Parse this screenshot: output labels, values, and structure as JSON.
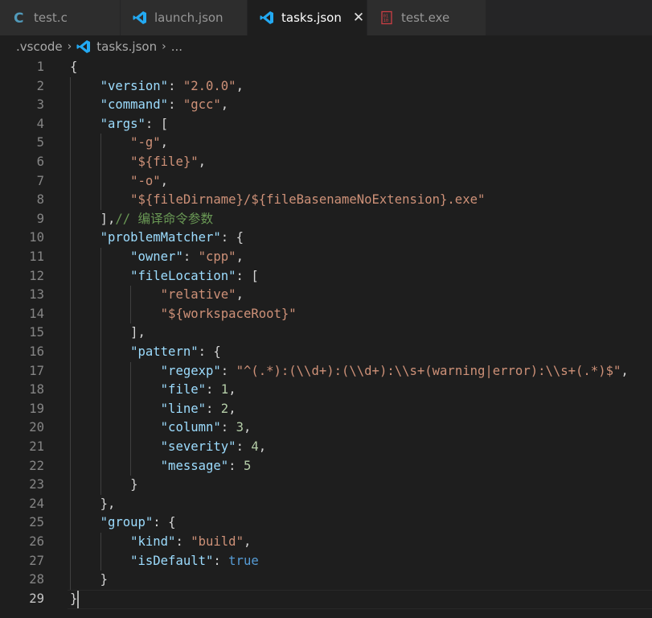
{
  "tabs": [
    {
      "label": "test.c",
      "icon": "c-file-icon",
      "icon_color": "#519aba",
      "active": false
    },
    {
      "label": "launch.json",
      "icon": "vscode-icon",
      "icon_color": "#23a9f2",
      "active": false
    },
    {
      "label": "tasks.json",
      "icon": "vscode-icon",
      "icon_color": "#23a9f2",
      "active": true,
      "close_glyph": "✕"
    },
    {
      "label": "test.exe",
      "icon": "binary-file-icon",
      "icon_color": "#cc3e44",
      "active": false
    }
  ],
  "breadcrumb": {
    "folder": ".vscode",
    "separator": "›",
    "file": "tasks.json",
    "more": "..."
  },
  "editor": {
    "current_line": 29,
    "lines": [
      {
        "num": "1",
        "code": "{"
      },
      {
        "num": "2",
        "code": "    \"version\": \"2.0.0\","
      },
      {
        "num": "3",
        "code": "    \"command\": \"gcc\","
      },
      {
        "num": "4",
        "code": "    \"args\": ["
      },
      {
        "num": "5",
        "code": "        \"-g\","
      },
      {
        "num": "6",
        "code": "        \"${file}\","
      },
      {
        "num": "7",
        "code": "        \"-o\","
      },
      {
        "num": "8",
        "code": "        \"${fileDirname}/${fileBasenameNoExtension}.exe\""
      },
      {
        "num": "9",
        "code": "    ],// 编译命令参数"
      },
      {
        "num": "10",
        "code": "    \"problemMatcher\": {"
      },
      {
        "num": "11",
        "code": "        \"owner\": \"cpp\","
      },
      {
        "num": "12",
        "code": "        \"fileLocation\": ["
      },
      {
        "num": "13",
        "code": "            \"relative\","
      },
      {
        "num": "14",
        "code": "            \"${workspaceRoot}\""
      },
      {
        "num": "15",
        "code": "        ],"
      },
      {
        "num": "16",
        "code": "        \"pattern\": {"
      },
      {
        "num": "17",
        "code": "            \"regexp\": \"^(.*):(\\\\d+):(\\\\d+):\\\\s+(warning|error):\\\\s+(.*)$\","
      },
      {
        "num": "18",
        "code": "            \"file\": 1,"
      },
      {
        "num": "19",
        "code": "            \"line\": 2,"
      },
      {
        "num": "20",
        "code": "            \"column\": 3,"
      },
      {
        "num": "21",
        "code": "            \"severity\": 4,"
      },
      {
        "num": "22",
        "code": "            \"message\": 5"
      },
      {
        "num": "23",
        "code": "        }"
      },
      {
        "num": "24",
        "code": "    },"
      },
      {
        "num": "25",
        "code": "    \"group\": {"
      },
      {
        "num": "26",
        "code": "        \"kind\": \"build\","
      },
      {
        "num": "27",
        "code": "        \"isDefault\": true"
      },
      {
        "num": "28",
        "code": "    }"
      },
      {
        "num": "29",
        "code": "}"
      }
    ]
  }
}
